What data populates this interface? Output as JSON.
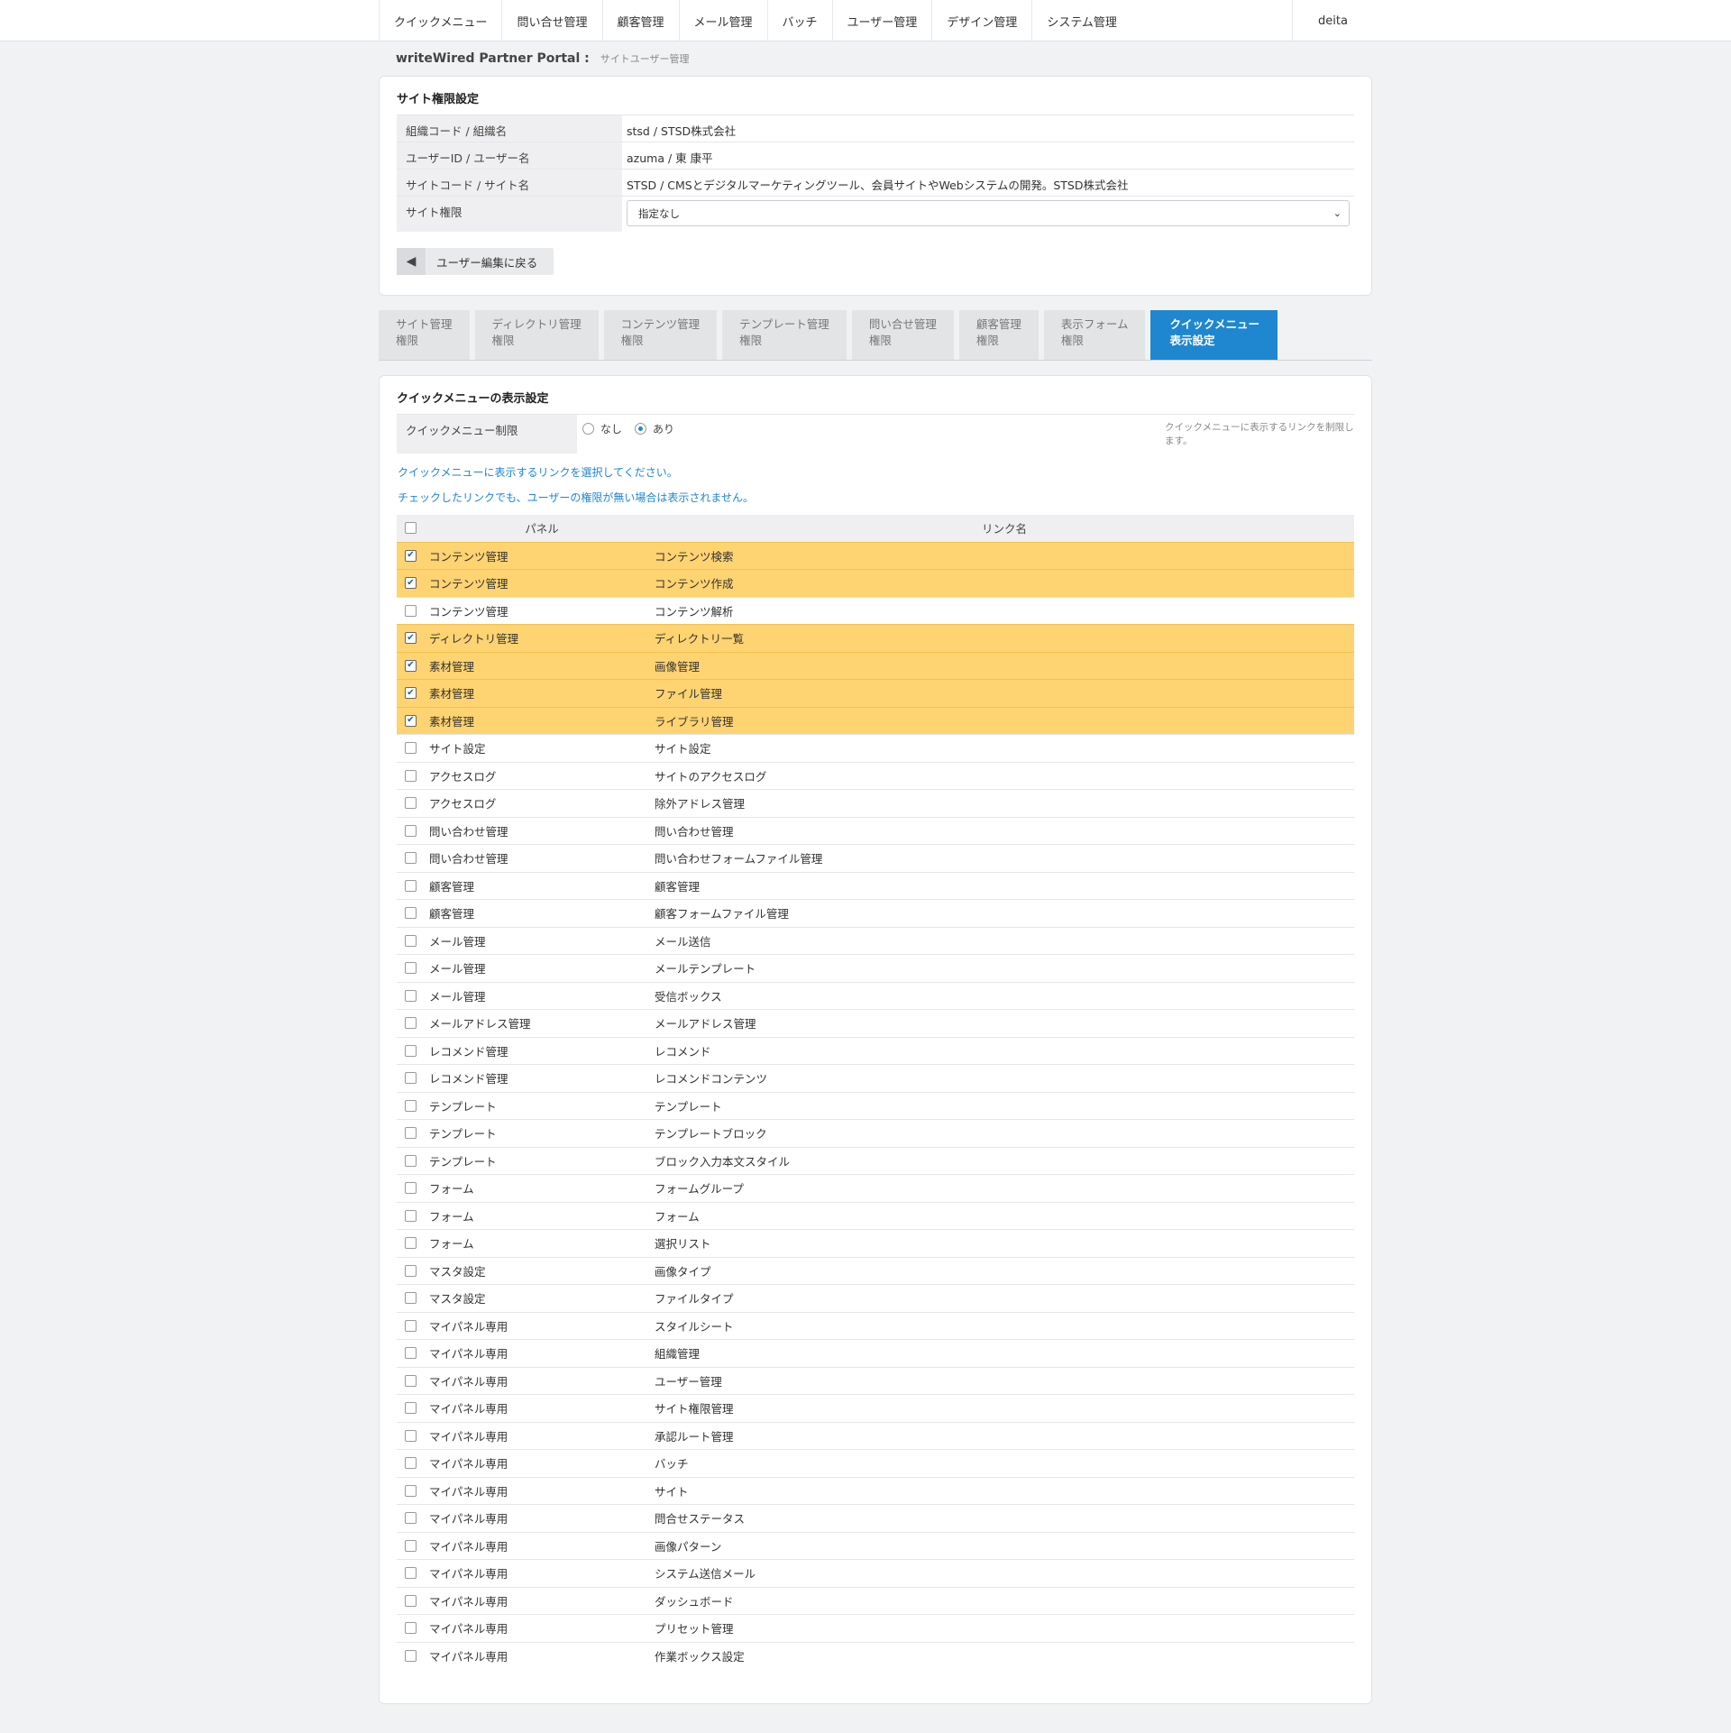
{
  "topnav": {
    "items": [
      "クイックメニュー",
      "問い合せ管理",
      "顧客管理",
      "メール管理",
      "バッチ",
      "ユーザー管理",
      "デザイン管理",
      "システム管理"
    ],
    "user": "deita"
  },
  "breadcrumb": {
    "brand": "writeWired Partner Portal :",
    "page": "サイトユーザー管理"
  },
  "site_permission": {
    "title": "サイト権限設定",
    "rows": [
      {
        "label": "組織コード / 組織名",
        "value": "stsd / STSD株式会社"
      },
      {
        "label": "ユーザーID / ユーザー名",
        "value": "azuma / 東 康平"
      },
      {
        "label": "サイトコード / サイト名",
        "value": "STSD / CMSとデジタルマーケティングツール、会員サイトやWebシステムの開発。STSD株式会社"
      }
    ],
    "permission_label": "サイト権限",
    "permission_selected": "指定なし",
    "back_button": "ユーザー編集に戻る"
  },
  "tabs": [
    {
      "line1": "サイト管理",
      "line2": "権限",
      "active": false
    },
    {
      "line1": "ディレクトリ管理",
      "line2": "権限",
      "active": false
    },
    {
      "line1": "コンテンツ管理",
      "line2": "権限",
      "active": false
    },
    {
      "line1": "テンプレート管理",
      "line2": "権限",
      "active": false
    },
    {
      "line1": "問い合せ管理",
      "line2": "権限",
      "active": false
    },
    {
      "line1": "顧客管理",
      "line2": "権限",
      "active": false
    },
    {
      "line1": "表示フォーム",
      "line2": "権限",
      "active": false
    },
    {
      "line1": "クイックメニュー",
      "line2": "表示設定",
      "active": true
    }
  ],
  "quick_menu": {
    "title": "クイックメニューの表示設定",
    "limit_label": "クイックメニュー制限",
    "option_none": "なし",
    "option_yes": "あり",
    "selected": "あり",
    "help": "クイックメニューに表示するリンクを制限します。",
    "note1": "クイックメニューに表示するリンクを選択してください。",
    "note2": "チェックしたリンクでも、ユーザーの権限が無い場合は表示されません。",
    "header_panel": "パネル",
    "header_link": "リンク名",
    "rows": [
      {
        "panel": "コンテンツ管理",
        "link": "コンテンツ検索",
        "checked": true
      },
      {
        "panel": "コンテンツ管理",
        "link": "コンテンツ作成",
        "checked": true
      },
      {
        "panel": "コンテンツ管理",
        "link": "コンテンツ解析",
        "checked": false
      },
      {
        "panel": "ディレクトリ管理",
        "link": "ディレクトリ一覧",
        "checked": true
      },
      {
        "panel": "素材管理",
        "link": "画像管理",
        "checked": true
      },
      {
        "panel": "素材管理",
        "link": "ファイル管理",
        "checked": true
      },
      {
        "panel": "素材管理",
        "link": "ライブラリ管理",
        "checked": true
      },
      {
        "panel": "サイト設定",
        "link": "サイト設定",
        "checked": false
      },
      {
        "panel": "アクセスログ",
        "link": "サイトのアクセスログ",
        "checked": false
      },
      {
        "panel": "アクセスログ",
        "link": "除外アドレス管理",
        "checked": false
      },
      {
        "panel": "問い合わせ管理",
        "link": "問い合わせ管理",
        "checked": false
      },
      {
        "panel": "問い合わせ管理",
        "link": "問い合わせフォームファイル管理",
        "checked": false
      },
      {
        "panel": "顧客管理",
        "link": "顧客管理",
        "checked": false
      },
      {
        "panel": "顧客管理",
        "link": "顧客フォームファイル管理",
        "checked": false
      },
      {
        "panel": "メール管理",
        "link": "メール送信",
        "checked": false
      },
      {
        "panel": "メール管理",
        "link": "メールテンプレート",
        "checked": false
      },
      {
        "panel": "メール管理",
        "link": "受信ボックス",
        "checked": false
      },
      {
        "panel": "メールアドレス管理",
        "link": "メールアドレス管理",
        "checked": false
      },
      {
        "panel": "レコメンド管理",
        "link": "レコメンド",
        "checked": false
      },
      {
        "panel": "レコメンド管理",
        "link": "レコメンドコンテンツ",
        "checked": false
      },
      {
        "panel": "テンプレート",
        "link": "テンプレート",
        "checked": false
      },
      {
        "panel": "テンプレート",
        "link": "テンプレートブロック",
        "checked": false
      },
      {
        "panel": "テンプレート",
        "link": "ブロック入力本文スタイル",
        "checked": false
      },
      {
        "panel": "フォーム",
        "link": "フォームグループ",
        "checked": false
      },
      {
        "panel": "フォーム",
        "link": "フォーム",
        "checked": false
      },
      {
        "panel": "フォーム",
        "link": "選択リスト",
        "checked": false
      },
      {
        "panel": "マスタ設定",
        "link": "画像タイプ",
        "checked": false
      },
      {
        "panel": "マスタ設定",
        "link": "ファイルタイプ",
        "checked": false
      },
      {
        "panel": "マイパネル専用",
        "link": "スタイルシート",
        "checked": false
      },
      {
        "panel": "マイパネル専用",
        "link": "組織管理",
        "checked": false
      },
      {
        "panel": "マイパネル専用",
        "link": "ユーザー管理",
        "checked": false
      },
      {
        "panel": "マイパネル専用",
        "link": "サイト権限管理",
        "checked": false
      },
      {
        "panel": "マイパネル専用",
        "link": "承認ルート管理",
        "checked": false
      },
      {
        "panel": "マイパネル専用",
        "link": "バッチ",
        "checked": false
      },
      {
        "panel": "マイパネル専用",
        "link": "サイト",
        "checked": false
      },
      {
        "panel": "マイパネル専用",
        "link": "問合せステータス",
        "checked": false
      },
      {
        "panel": "マイパネル専用",
        "link": "画像パターン",
        "checked": false
      },
      {
        "panel": "マイパネル専用",
        "link": "システム送信メール",
        "checked": false
      },
      {
        "panel": "マイパネル専用",
        "link": "ダッシュボード",
        "checked": false
      },
      {
        "panel": "マイパネル専用",
        "link": "プリセット管理",
        "checked": false
      },
      {
        "panel": "マイパネル専用",
        "link": "作業ボックス設定",
        "checked": false
      }
    ]
  },
  "colors": {
    "accent": "#1f87cf",
    "checked_row": "#fed371"
  }
}
